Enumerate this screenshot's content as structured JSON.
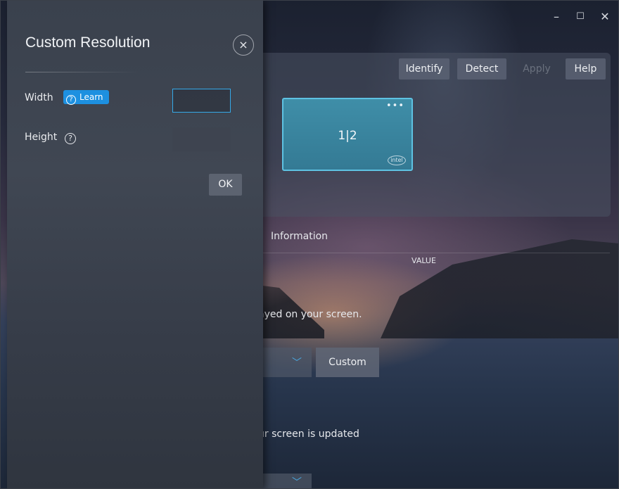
{
  "window": {
    "controls": {
      "minimize": "–",
      "maximize": "☐",
      "close": "✕"
    }
  },
  "toolbar": {
    "identify": "Identify",
    "detect": "Detect",
    "apply": "Apply",
    "help": "Help"
  },
  "display_card": {
    "label": "1|2",
    "menu": "•••",
    "brand": "intel"
  },
  "background": {
    "information_tab": "Information",
    "value_header": "VALUE",
    "text_fragment_1": "ayed on your screen.",
    "custom_button": "Custom",
    "text_fragment_2": "ur screen is updated"
  },
  "flyout": {
    "title": "Custom Resolution",
    "close_symbol": "×",
    "width_label": "Width",
    "learn_label": "Learn",
    "height_label": "Height",
    "help_symbol": "?",
    "width_value": "",
    "height_value": "",
    "ok_label": "OK"
  },
  "colors": {
    "accent": "#1d90e0",
    "focus_border": "#35a9e8",
    "display_card": "#3f8ea8"
  }
}
